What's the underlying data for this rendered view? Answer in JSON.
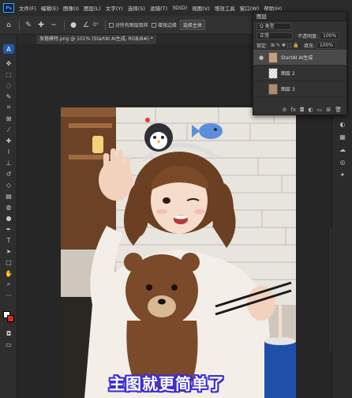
{
  "app": {
    "logo": "Ps"
  },
  "menu": [
    "文件(F)",
    "编辑(E)",
    "图像(I)",
    "图层(L)",
    "文字(Y)",
    "选择(S)",
    "滤镜(T)",
    "3D(D)",
    "视图(V)",
    "增效工具",
    "窗口(W)",
    "帮助(H)"
  ],
  "options": {
    "zoom": "0°",
    "sample_all_layers": "对所有图层取样",
    "enhance_edge": "增强边缘",
    "select_subject": "选择主体"
  },
  "document": {
    "tab_title": "发箍模特.png @ 101% (StartAI AI生成, RGB/8#) *"
  },
  "layers_panel": {
    "title": "图层",
    "filter": "Q 类型",
    "blend_mode": "正常",
    "opacity_label": "不透明度:",
    "opacity": "100%",
    "lock_label": "锁定:",
    "fill_label": "填充:",
    "fill": "100%",
    "layers": [
      {
        "name": "StartAI AI生成",
        "selected": true
      },
      {
        "name": "图层 2",
        "selected": false
      },
      {
        "name": "图层 3",
        "selected": false
      }
    ]
  },
  "subtitle": "主图就更简单了",
  "colors": {
    "foreground": "#ffffff",
    "background": "#d32a1e",
    "accent": "#1f5aa8"
  }
}
